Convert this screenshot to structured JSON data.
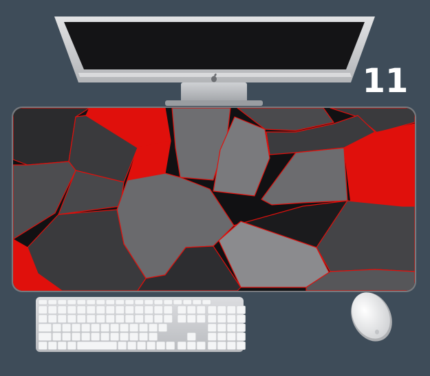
{
  "product_number": "11",
  "colors": {
    "background": "#3e4c59",
    "mat_dark": "#2b2b2d",
    "mat_gray": "#6b6b6e",
    "accent_red": "#e0100c",
    "monitor_frame": "#c9cbce",
    "screen": "#141416",
    "keyboard": "#e9eaec",
    "mouse": "#f1f2f4"
  },
  "objects": [
    "imac-monitor",
    "apple-logo-icon",
    "desk-mat",
    "keyboard",
    "mouse"
  ]
}
